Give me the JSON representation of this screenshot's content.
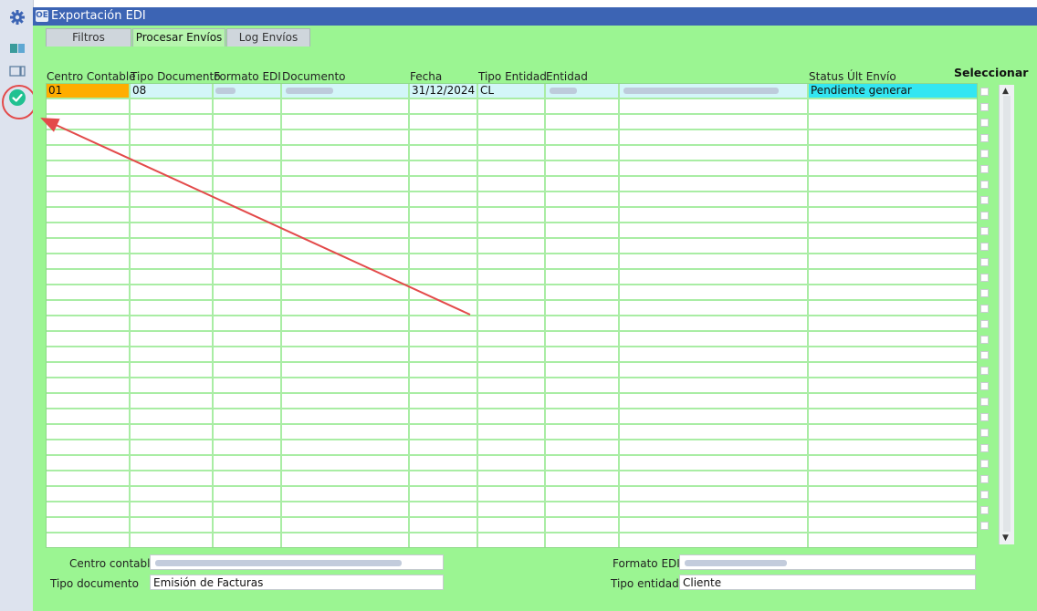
{
  "window": {
    "title": "Exportación EDI",
    "app_icon_text": "OE"
  },
  "toolbar": {
    "items": [
      {
        "icon": "gear-icon"
      },
      {
        "icon": "layout-icon"
      },
      {
        "icon": "panel-icon"
      },
      {
        "icon": "check-circle-icon"
      }
    ]
  },
  "tabs": [
    {
      "label": "Filtros"
    },
    {
      "label": "Procesar Envíos",
      "active": true
    },
    {
      "label": "Log Envíos"
    }
  ],
  "grid": {
    "columns": [
      "Centro Contable",
      "Tipo Documento",
      "Formato EDI",
      "Documento",
      "Fecha",
      "Tipo Entidad",
      "Entidad",
      "",
      "Status Últ Envío"
    ],
    "select_header": "Seleccionar",
    "row": {
      "centro_contable": "01",
      "tipo_documento": "08",
      "formato_edi": "",
      "documento": "",
      "fecha": "31/12/2024",
      "tipo_entidad": "CL",
      "entidad": "",
      "entidad_nombre": "",
      "status": "Pendiente generar"
    }
  },
  "scrollbar": {
    "up_arrow": "▲",
    "down_arrow": "▼"
  },
  "form": {
    "centro_contable_label": "Centro contable",
    "centro_contable_value": "",
    "tipo_documento_label": "Tipo documento",
    "tipo_documento_value": "Emisión de Facturas",
    "formato_edi_label": "Formato EDI",
    "formato_edi_value": "",
    "tipo_entidad_label": "Tipo entidad",
    "tipo_entidad_value": "Cliente"
  },
  "colors": {
    "background": "#9bf592",
    "titlebar": "#3c64b4",
    "highlight_orange": "#ffad00",
    "highlight_cyan": "#33e6f2",
    "row_selected": "#d3f6f8",
    "annotation_red": "#e34a4a"
  }
}
